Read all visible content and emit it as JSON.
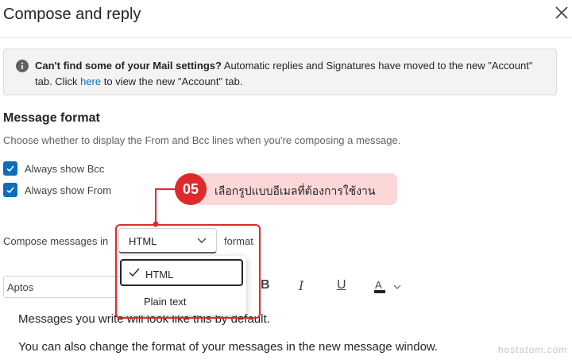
{
  "panel": {
    "title": "Compose and reply",
    "close_icon": "close-icon"
  },
  "banner": {
    "bold_text": "Can't find some of your Mail settings?",
    "text_before_link": " Automatic replies and Signatures have moved to the new \"Account\" tab. Click ",
    "link_text": "here",
    "text_after_link": " to view the new \"Account\" tab.",
    "icon": "info-icon"
  },
  "message_format": {
    "heading": "Message format",
    "description": "Choose whether to display the From and Bcc lines when you're composing a message.",
    "always_show_bcc": {
      "label": "Always show Bcc",
      "checked": true
    },
    "always_show_from": {
      "label": "Always show From",
      "checked": true
    },
    "compose_label": "Compose messages in",
    "selected_format": "HTML",
    "format_suffix": "format",
    "options": [
      "HTML",
      "Plain text"
    ]
  },
  "toolbar": {
    "font_name": "Aptos",
    "bold": "B",
    "italic": "I",
    "underline": "U",
    "font_color_icon": "font-color-icon"
  },
  "preview": {
    "line1": "Messages you write will look like this by default.",
    "line2": "You can also change the format of your messages in the new message window."
  },
  "annotation": {
    "step_number": "05",
    "step_text": "เลือกรูปแบบอีเมลที่ต้องการใช้งาน"
  },
  "watermark": "hostatom.com",
  "colors": {
    "accent": "#0f6cbd",
    "annotation_red": "#e0292d",
    "annotation_pill": "#fbd7d7"
  }
}
